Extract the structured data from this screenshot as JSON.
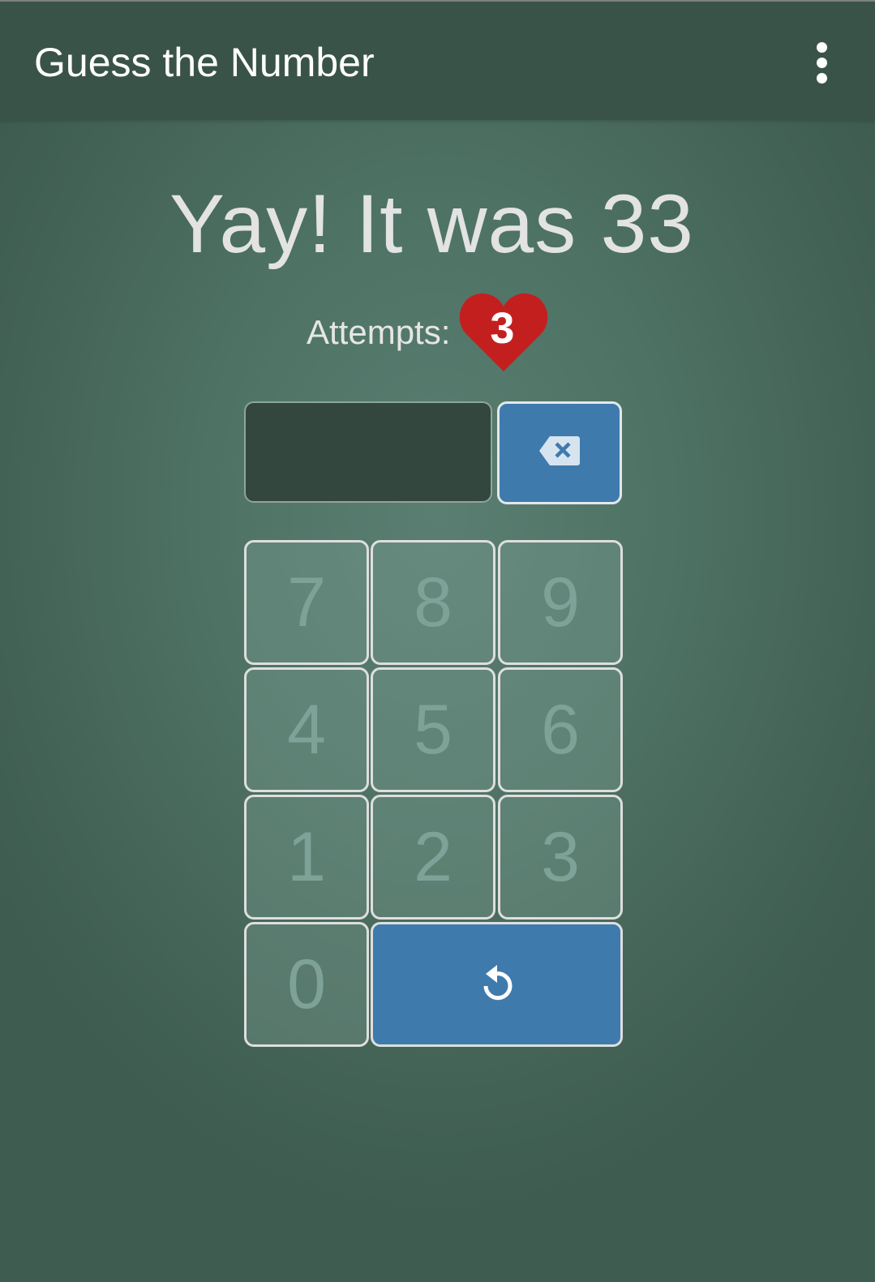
{
  "app_bar": {
    "title": "Guess the Number",
    "menu_icon": "more-vert-icon"
  },
  "game": {
    "result_message": "Yay! It was 33",
    "attempts_label": "Attempts:",
    "attempts_count": "3",
    "attempts_icon": "heart-icon",
    "display_value": ""
  },
  "keypad": {
    "keys": [
      "7",
      "8",
      "9",
      "4",
      "5",
      "6",
      "1",
      "2",
      "3",
      "0"
    ],
    "backspace_icon": "backspace-icon",
    "restart_icon": "restart-icon"
  },
  "colors": {
    "app_bar": "#3a5349",
    "background": "#4f7466",
    "accent_blue": "#3f7aad",
    "heart_red": "#c41f1f",
    "key_text": "#7ea297"
  }
}
